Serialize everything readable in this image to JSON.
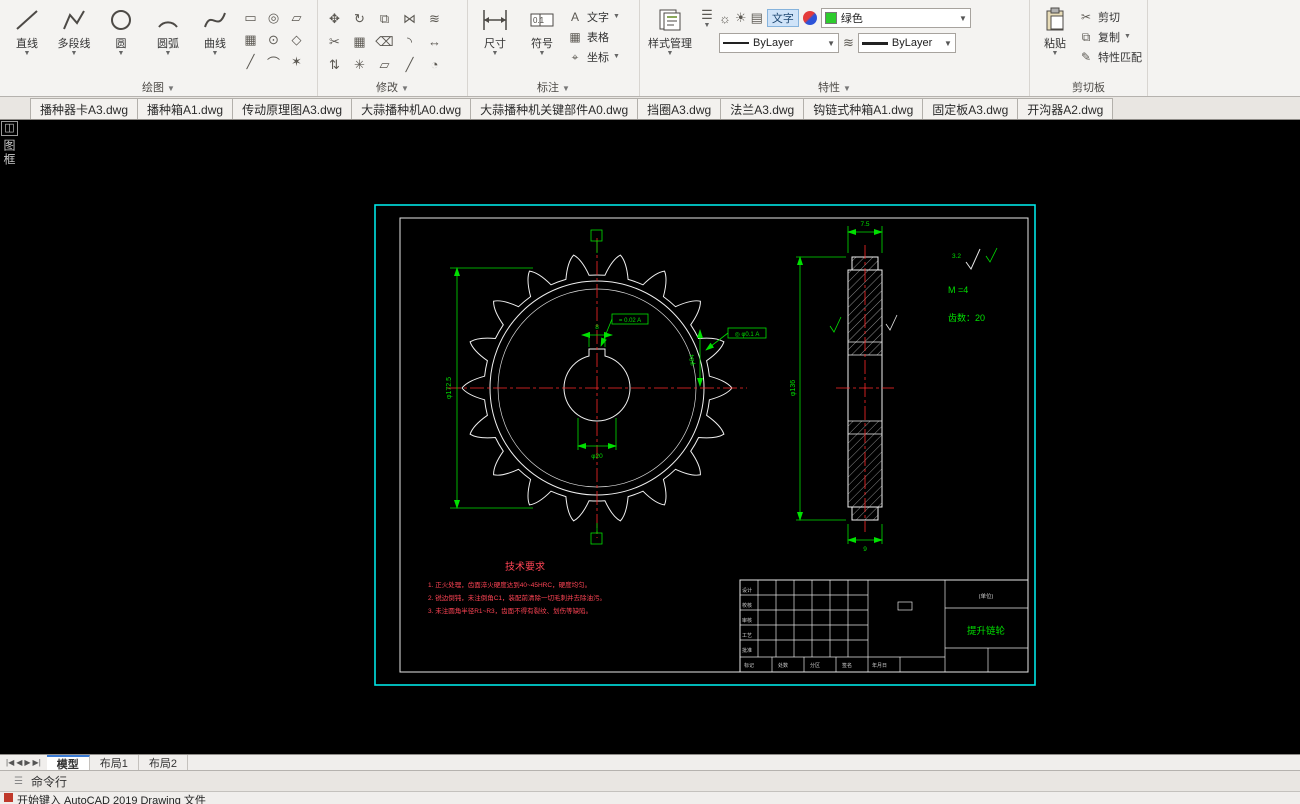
{
  "ribbon": {
    "panels": {
      "draw": "绘图",
      "modify": "修改",
      "annotate": "标注",
      "properties": "特性",
      "clipboard": "剪切板"
    },
    "draw_tools": [
      {
        "label": "直线"
      },
      {
        "label": "多段线"
      },
      {
        "label": "圆"
      },
      {
        "label": "圆弧"
      },
      {
        "label": "曲线"
      }
    ],
    "draw_extra_glyphs": [
      "▭",
      "◎",
      "▱",
      "▦",
      "⊙",
      "◇",
      "╱",
      "⌒",
      "✶"
    ],
    "modify_glyphs": [
      "✥",
      "↻",
      "⧉",
      "⋈",
      "≋",
      "✂",
      "▦",
      "⌫",
      "◝",
      "↔",
      "⇅",
      "✳",
      "▱",
      "╱",
      "◔"
    ],
    "annotate": {
      "dimension": "尺寸",
      "symbol": "符号",
      "text": "文字",
      "table": "表格",
      "coordinate": "坐标"
    },
    "properties": {
      "style_manager": "样式管理",
      "text_chip": "文字",
      "color_value": "绿色",
      "layer_value": "ByLayer",
      "lineweight_value": "ByLayer"
    },
    "clipboard": {
      "paste": "粘贴",
      "cut": "剪切",
      "copy": "复制",
      "match": "特性匹配"
    }
  },
  "file_tabs": [
    "播种器卡A3.dwg",
    "播种箱A1.dwg",
    "传动原理图A3.dwg",
    "大蒜播种机A0.dwg",
    "大蒜播种机关键部件A0.dwg",
    "挡圈A3.dwg",
    "法兰A3.dwg",
    "钩链式种箱A1.dwg",
    "固定板A3.dwg",
    "开沟器A2.dwg"
  ],
  "canvas": {
    "palette_label": "图框"
  },
  "drawing": {
    "tech_title": "技术要求",
    "notes": [
      "1. 正火处理，齿面淬火硬度达到40~45HRC，硬度均匀。",
      "2. 锐边倒钝，未注倒角C1，装配前清除一切毛刺并去除油污。",
      "3. 未注圆角半径R1~R3，齿面不得有裂纹、划伤等缺陷。"
    ],
    "module_text": "M =4",
    "teeth_text": "齿数：20",
    "dims": {
      "outer_dia": "φ172.5",
      "bore_dia": "φ20",
      "keyway_w": "8",
      "rim_w": "7.5",
      "hub_w": "9",
      "side_dia": "φ136",
      "ref_dia": "φ84",
      "tol_frame": "◎ φ0.1 A",
      "tol_frame2": "= 0.02 A",
      "roughness": "3.2"
    },
    "title_block": {
      "part_name": "提升链轮",
      "org": "(单位)",
      "col_labels": [
        "设计",
        "校核",
        "审核",
        "工艺",
        "批准"
      ],
      "row_labels": [
        "标记",
        "处数",
        "分区",
        "签名",
        "年月日"
      ]
    }
  },
  "layout_tabs": [
    "模型",
    "布局1",
    "布局2"
  ],
  "command": {
    "label": "命令行"
  },
  "status": {
    "hint": "开始键入 AutoCAD 2019 Drawing 文件"
  }
}
